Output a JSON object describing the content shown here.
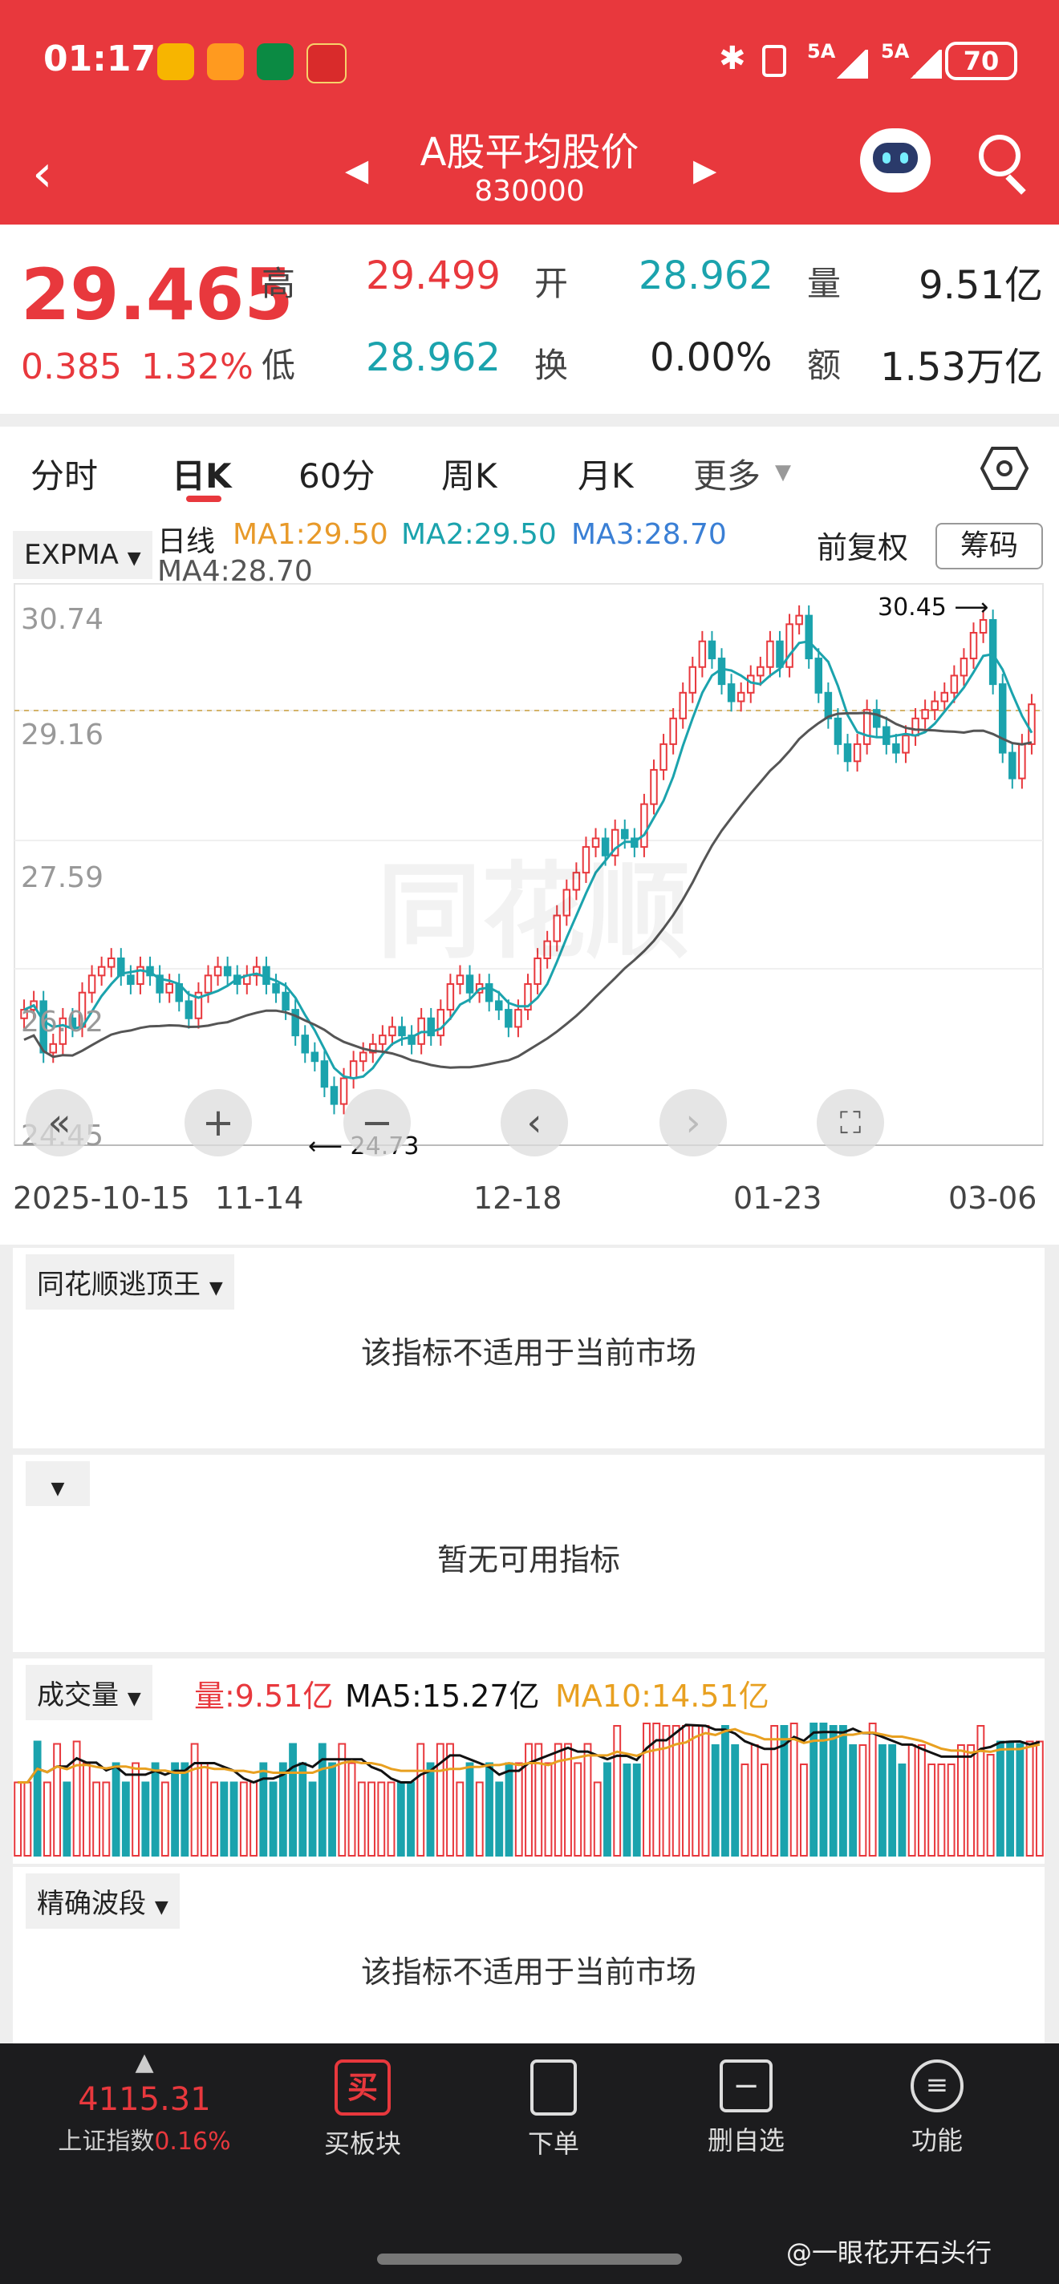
{
  "status": {
    "time": "01:17",
    "signal1": "5A",
    "signal2": "5A",
    "battery": "70",
    "app_icons": [
      "weibo-icon",
      "app-orange-icon",
      "postal-icon",
      "red-app-icon"
    ]
  },
  "nav": {
    "title": "A股平均股价",
    "code": "830000"
  },
  "quote": {
    "price": "29.465",
    "change": "0.385",
    "change_pct": "1.32%",
    "high_label": "高",
    "high": "29.499",
    "open_label": "开",
    "open": "28.962",
    "volume_label": "量",
    "volume": "9.51亿",
    "low_label": "低",
    "low": "28.962",
    "turnover_label": "换",
    "turnover": "0.00%",
    "amount_label": "额",
    "amount": "1.53万亿"
  },
  "tabs": {
    "items": [
      "分时",
      "日K",
      "60分",
      "周K",
      "月K",
      "更多"
    ],
    "active": "日K"
  },
  "chart": {
    "indicator": "EXPMA",
    "line_label": "日线",
    "ma1": "MA1:29.50",
    "ma2": "MA2:29.50",
    "ma3": "MA3:28.70",
    "ma4": "MA4:28.70",
    "adjust": "前复权",
    "chips": "筹码",
    "high_marker": "30.45",
    "low_marker": "24.73",
    "watermark": "同花顺",
    "colors": {
      "up": "#e8383d",
      "down": "#1ba3ad",
      "ma1": "#e89a2a",
      "ma2": "#1ba3ad",
      "ma3": "#3a7fd5",
      "ma4": "#555555",
      "td": "#f0a020"
    }
  },
  "chart_data": {
    "type": "candlestick",
    "y_ticks": [
      "30.74",
      "29.16",
      "27.59",
      "26.02",
      "24.45"
    ],
    "x_ticks": [
      "2025-10-15",
      "11-14",
      "12-18",
      "01-23",
      "03-06"
    ],
    "ylim": [
      24.45,
      30.74
    ],
    "series_close": [
      25.9,
      26.0,
      25.4,
      25.5,
      25.8,
      25.7,
      26.1,
      26.3,
      26.4,
      26.5,
      26.3,
      26.2,
      26.4,
      26.3,
      26.1,
      26.2,
      26.0,
      25.8,
      26.1,
      26.3,
      26.4,
      26.3,
      26.2,
      26.3,
      26.4,
      26.2,
      26.1,
      25.9,
      25.6,
      25.4,
      25.3,
      25.0,
      24.8,
      25.1,
      25.3,
      25.4,
      25.5,
      25.6,
      25.7,
      25.6,
      25.5,
      25.8,
      25.6,
      25.9,
      26.2,
      26.3,
      26.1,
      26.2,
      26.0,
      25.9,
      25.7,
      25.9,
      26.2,
      26.5,
      26.7,
      27.0,
      27.3,
      27.5,
      27.8,
      27.9,
      27.7,
      28.0,
      27.9,
      27.8,
      28.3,
      28.7,
      29.0,
      29.3,
      29.6,
      29.9,
      30.2,
      30.0,
      29.7,
      29.5,
      29.6,
      29.8,
      29.9,
      30.2,
      29.9,
      30.4,
      30.5,
      30.0,
      29.6,
      29.3,
      29.0,
      28.8,
      29.0,
      29.4,
      29.2,
      29.0,
      28.9,
      29.1,
      29.3,
      29.4,
      29.5,
      29.6,
      29.8,
      30.0,
      30.3,
      30.45,
      29.7,
      28.9,
      28.6,
      29.0,
      29.465
    ]
  },
  "controls": [
    "fast-back-icon",
    "zoom-in-icon",
    "zoom-out-icon",
    "prev-icon",
    "next-icon",
    "fullscreen-icon"
  ],
  "panels": {
    "p1_name": "同花顺逃顶王",
    "p1_msg": "该指标不适用于当前市场",
    "p2_msg": "暂无可用指标",
    "vol_name": "成交量",
    "vol_value": "量:9.51亿",
    "vol_ma5": "MA5:15.27亿",
    "vol_ma10": "MA10:14.51亿",
    "p3_name": "精确波段",
    "p3_msg": "该指标不适用于当前市场"
  },
  "bottom": {
    "index_value": "4115.31",
    "index_name": "上证指数",
    "index_pct": "0.16%",
    "buy_icon_text": "买",
    "buy_label": "买板块",
    "order_label": "下单",
    "remove_label": "删自选",
    "func_label": "功能",
    "watermark": "@一眼花开石头行"
  }
}
